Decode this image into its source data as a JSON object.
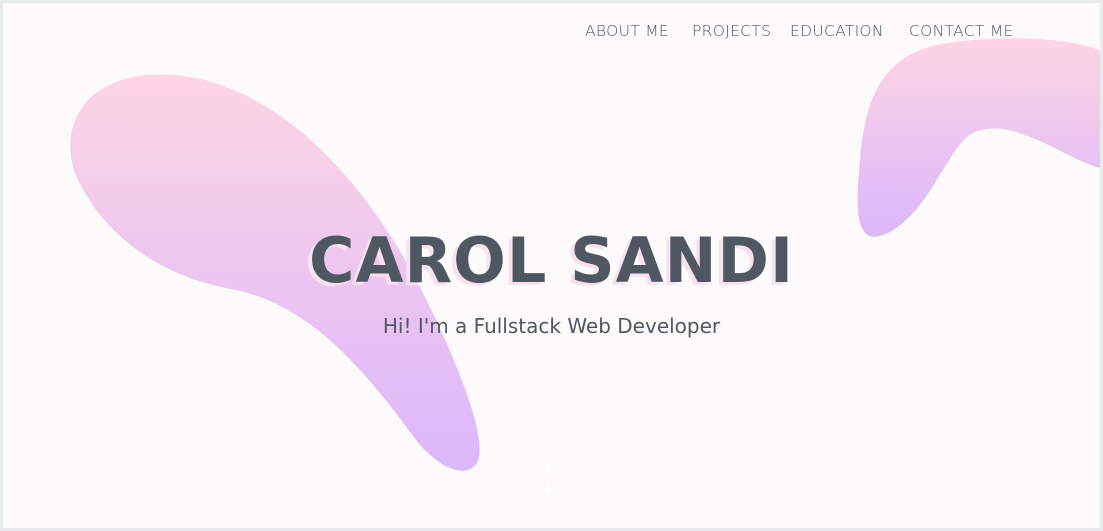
{
  "nav": {
    "items": [
      {
        "label": "ABOUT ME"
      },
      {
        "label": "PROJECTS"
      },
      {
        "label": "EDUCATION"
      },
      {
        "label": "CONTACT ME"
      }
    ]
  },
  "hero": {
    "title": "CAROL SANDI",
    "subtitle": "Hi! I'm a Fullstack Web Developer"
  },
  "scroll_indicator": {
    "icon": "scroll-down-icon"
  },
  "colors": {
    "background": "#fdfafb",
    "frame": "#e7ebec",
    "text": "#4e5762",
    "blob_top": "#fdd5e3",
    "blob_bottom": "#dcb7fc",
    "title_shadow": "#f9e1ef"
  }
}
